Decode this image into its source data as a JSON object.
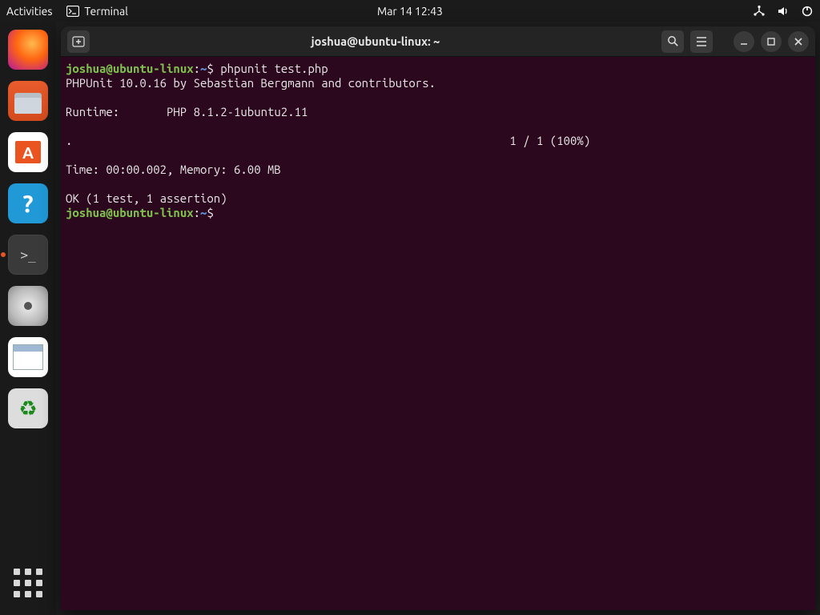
{
  "topbar": {
    "activities": "Activities",
    "app_name": "Terminal",
    "clock": "Mar 14  12:43"
  },
  "dock": {
    "items": [
      {
        "name": "firefox"
      },
      {
        "name": "files"
      },
      {
        "name": "software"
      },
      {
        "name": "help",
        "glyph": "?"
      },
      {
        "name": "terminal",
        "running": true,
        "active": true
      },
      {
        "name": "disk"
      },
      {
        "name": "text-editor"
      },
      {
        "name": "trash"
      }
    ]
  },
  "terminal": {
    "title": "joshua@ubuntu-linux: ~",
    "prompt": {
      "user": "joshua",
      "at": "@",
      "host": "ubuntu-linux",
      "colon": ":",
      "path": "~",
      "dollar": "$"
    },
    "session": {
      "command1": " phpunit test.php",
      "phpunit_banner": "PHPUnit 10.0.16 by Sebastian Bergmann and contributors.",
      "runtime_line": "Runtime:       PHP 8.1.2-1ubuntu2.11",
      "progress_dot": ".",
      "progress_count": "1 / 1 (100%)",
      "time_mem": "Time: 00:00.002, Memory: 6.00 MB",
      "result": "OK (1 test, 1 assertion)"
    }
  }
}
